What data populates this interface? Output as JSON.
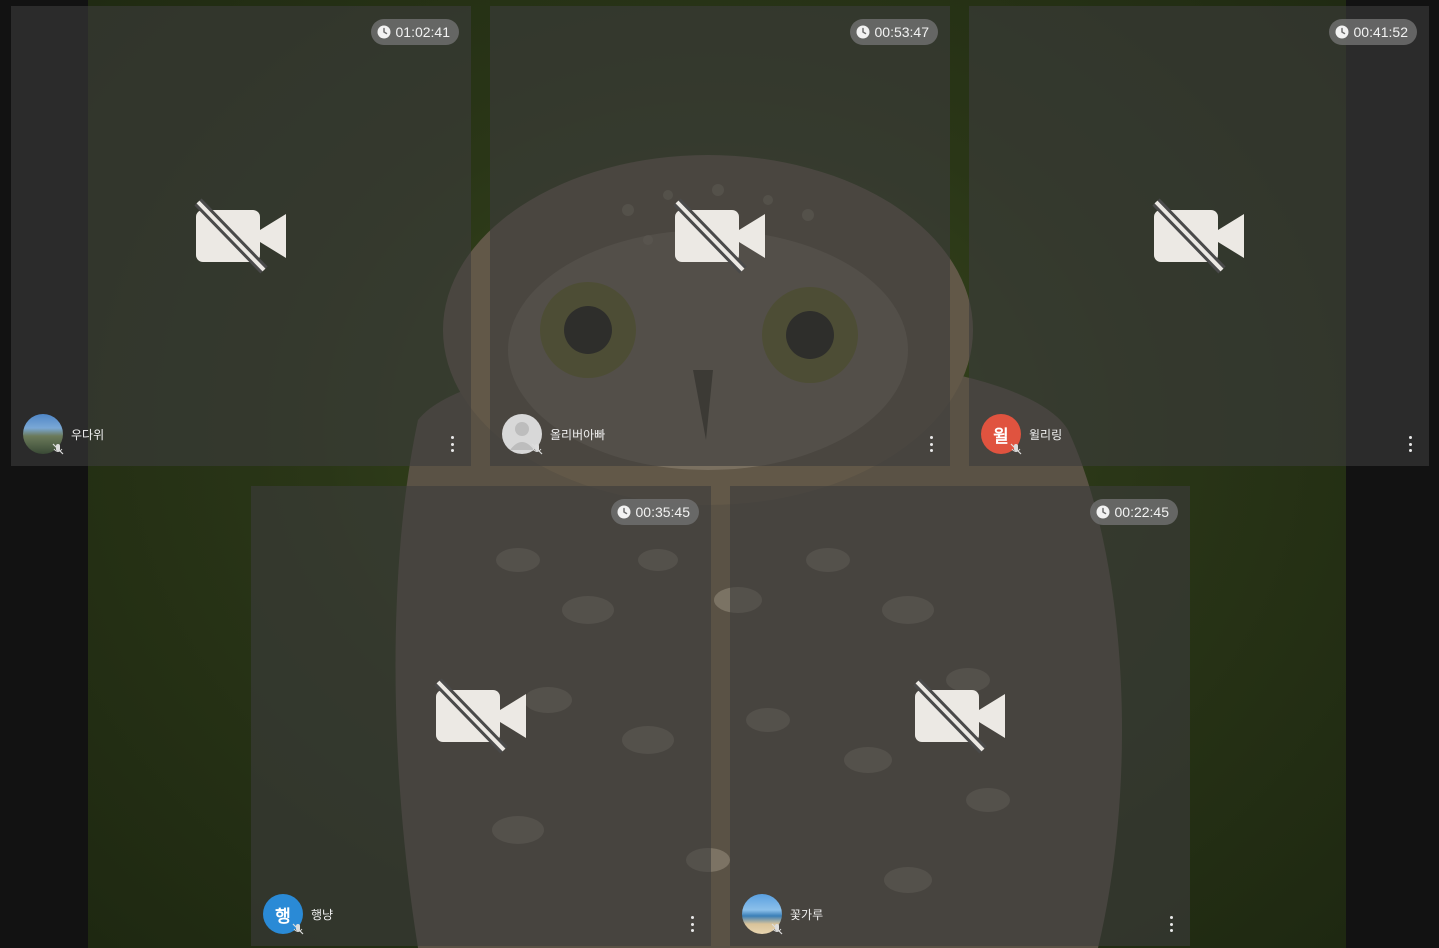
{
  "participants": [
    {
      "name": "우다위",
      "timer": "01:02:41",
      "avatar_style": "landscape-photo",
      "avatar_letter": ""
    },
    {
      "name": "올리버아빠",
      "timer": "00:53:47",
      "avatar_style": "default-person",
      "avatar_letter": ""
    },
    {
      "name": "윌리링",
      "timer": "00:41:52",
      "avatar_style": "letter",
      "avatar_letter": "윌",
      "avatar_color": "#e0533f"
    },
    {
      "name": "행냥",
      "timer": "00:35:45",
      "avatar_style": "letter",
      "avatar_letter": "행",
      "avatar_color": "#2a8ad6"
    },
    {
      "name": "꽃가루",
      "timer": "00:22:45",
      "avatar_style": "beach-photo",
      "avatar_letter": ""
    }
  ],
  "icons": {
    "timer": "clock-icon",
    "video": "video-off-icon",
    "mic": "mic-off-icon",
    "menu": "more-vert-icon"
  },
  "background": "owl-photo"
}
